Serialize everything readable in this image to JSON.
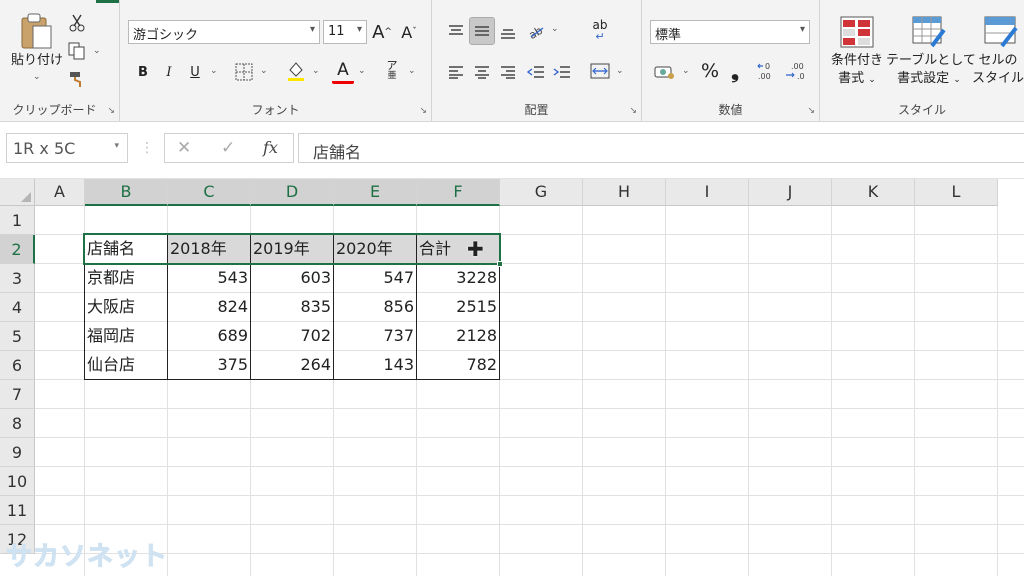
{
  "ribbon": {
    "clipboard": {
      "paste_label": "貼り付け",
      "group_label": "クリップボード"
    },
    "font": {
      "font_name": "游ゴシック",
      "font_size": "11",
      "bold": "B",
      "italic": "I",
      "underline": "U",
      "font_color_glyph": "A",
      "grow_glyph": "A",
      "shrink_glyph": "A",
      "phonetic_glyph": "ア",
      "group_label": "フォント"
    },
    "alignment": {
      "wrap_glyph": "ab",
      "group_label": "配置"
    },
    "number": {
      "format": "標準",
      "percent": "%",
      "comma": "❟",
      "group_label": "数値"
    },
    "styles": {
      "conditional_label_1": "条件付き",
      "conditional_label_2": "書式",
      "table_label_1": "テーブルとして",
      "table_label_2": "書式設定",
      "cell_label_1": "セルの",
      "cell_label_2": "スタイル",
      "group_label": "スタイル"
    }
  },
  "formula_bar": {
    "name_box": "1R x 5C",
    "formula": "店舗名",
    "fx": "fx",
    "cancel": "✕",
    "enter": "✓"
  },
  "sheet": {
    "columns": [
      "A",
      "B",
      "C",
      "D",
      "E",
      "F",
      "G",
      "H",
      "I",
      "J",
      "K",
      "L"
    ],
    "rows": [
      "1",
      "2",
      "3",
      "4",
      "5",
      "6",
      "7",
      "8",
      "9",
      "10",
      "11",
      "12"
    ],
    "table": {
      "headers": [
        "店舗名",
        "2018年",
        "2019年",
        "2020年",
        "合計"
      ],
      "rows": [
        [
          "京都店",
          "543",
          "603",
          "547",
          "3228"
        ],
        [
          "大阪店",
          "824",
          "835",
          "856",
          "2515"
        ],
        [
          "福岡店",
          "689",
          "702",
          "737",
          "2128"
        ],
        [
          "仙台店",
          "375",
          "264",
          "143",
          "782"
        ]
      ]
    }
  },
  "watermark": "サカソネット",
  "colors": {
    "accent": "#1e7145",
    "header_fill": "#d9d9d9"
  }
}
